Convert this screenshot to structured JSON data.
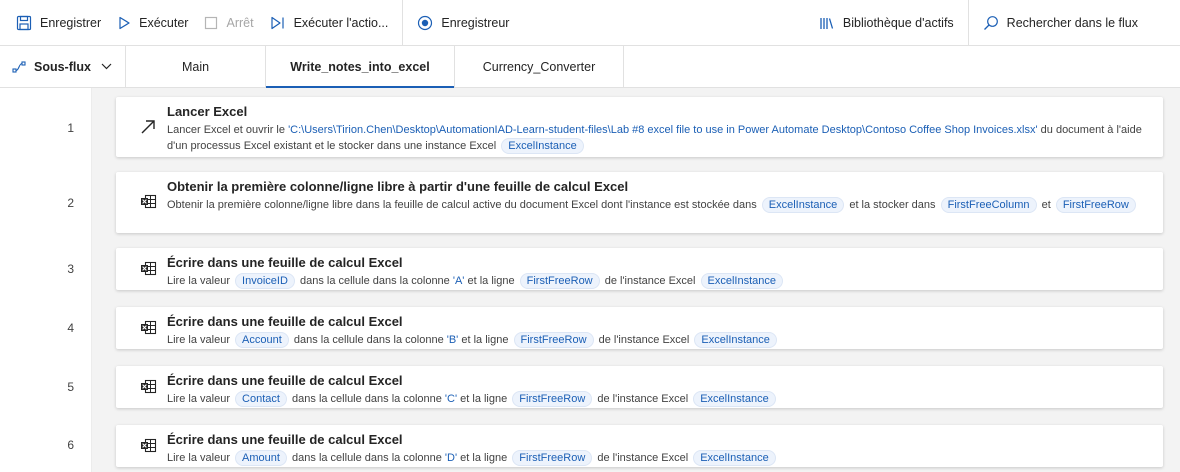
{
  "toolbar": {
    "save": "Enregistrer",
    "run": "Exécuter",
    "stop": "Arrêt",
    "run_action": "Exécuter l'actio...",
    "recorder": "Enregistreur",
    "assets": "Bibliothèque d'actifs",
    "search": "Rechercher dans le flux"
  },
  "tabs": {
    "subflows": "Sous-flux",
    "items": [
      "Main",
      "Write_notes_into_excel",
      "Currency_Converter"
    ],
    "active": "Write_notes_into_excel"
  },
  "steps": [
    {
      "num": "1",
      "title": "Lancer Excel",
      "d1": "Lancer Excel et ouvrir le",
      "path": "'C:\\Users\\Tirion.Chen\\Desktop\\AutomationIAD-Learn-student-files\\Lab #8 excel file to use in Power Automate Desktop\\Contoso Coffee Shop Invoices.xlsx'",
      "d2": "du document à l'aide d'un processus Excel existant et le stocker dans une instance Excel",
      "var1": "ExcelInstance"
    },
    {
      "num": "2",
      "title": "Obtenir la première colonne/ligne libre à partir d'une feuille de calcul Excel",
      "d1": "Obtenir la première colonne/ligne libre dans la feuille de calcul active du document Excel dont l'instance est stockée dans",
      "var1": "ExcelInstance",
      "d2": "et la stocker dans",
      "var2": "FirstFreeColumn",
      "d3": "et",
      "var3": "FirstFreeRow"
    },
    {
      "num": "3",
      "title": "Écrire dans une feuille de calcul Excel",
      "d1": "Lire la valeur",
      "var1": "InvoiceID",
      "d2": "dans la cellule dans la colonne",
      "col": "'A'",
      "d3": "et la ligne",
      "var2": "FirstFreeRow",
      "d4": "de l'instance Excel",
      "var3": "ExcelInstance"
    },
    {
      "num": "4",
      "title": "Écrire dans une feuille de calcul Excel",
      "d1": "Lire la valeur",
      "var1": "Account",
      "d2": "dans la cellule dans la colonne",
      "col": "'B'",
      "d3": "et la ligne",
      "var2": "FirstFreeRow",
      "d4": "de l'instance Excel",
      "var3": "ExcelInstance"
    },
    {
      "num": "5",
      "title": "Écrire dans une feuille de calcul Excel",
      "d1": "Lire la valeur",
      "var1": "Contact",
      "d2": "dans la cellule dans la colonne",
      "col": "'C'",
      "d3": "et la ligne",
      "var2": "FirstFreeRow",
      "d4": "de l'instance Excel",
      "var3": "ExcelInstance"
    },
    {
      "num": "6",
      "title": "Écrire dans une feuille de calcul Excel",
      "d1": "Lire la valeur",
      "var1": "Amount",
      "d2": "dans la cellule dans la colonne",
      "col": "'D'",
      "d3": "et la ligne",
      "var2": "FirstFreeRow",
      "d4": "de l'instance Excel",
      "var3": "ExcelInstance"
    }
  ],
  "icons": {
    "save": "save-icon",
    "run": "play-icon",
    "stop": "stop-icon",
    "run_action": "step-play-icon",
    "recorder": "record-icon",
    "assets": "library-icon",
    "search": "search-icon",
    "launch_excel": "launch-arrow-icon",
    "excel_action": "excel-sheet-icon"
  },
  "colors": {
    "accent": "#1b5fb5",
    "token_bg": "#edf3fc"
  }
}
